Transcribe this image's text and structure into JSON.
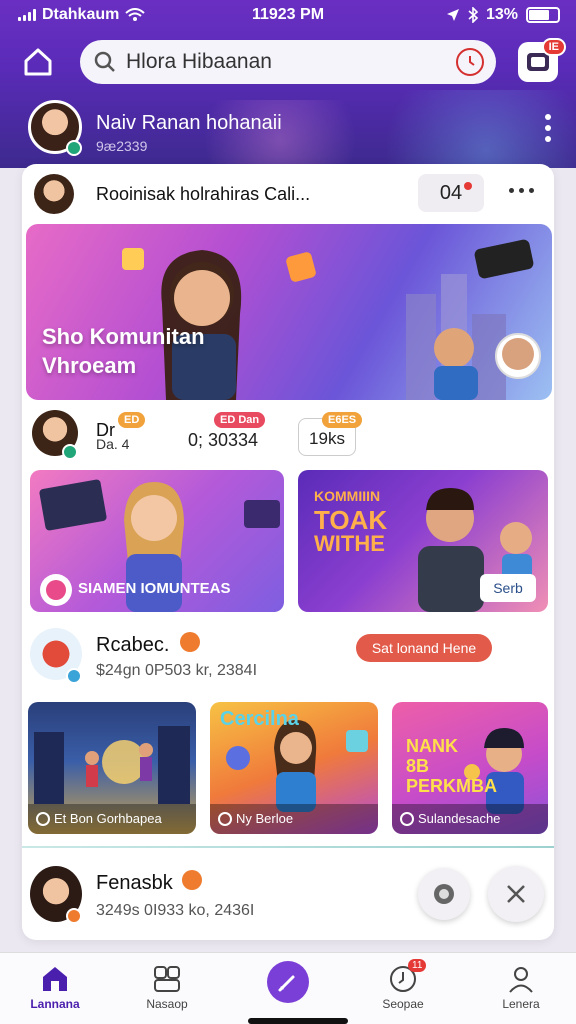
{
  "status_bar": {
    "carrier": "Dtahkaum",
    "time": "11923 PM",
    "battery": "13%"
  },
  "search": {
    "placeholder": "Hlora Hibaanan"
  },
  "header_badge": "IE",
  "profile": {
    "name": "Naiv Ranan hohanaii",
    "sub": "9æ2339"
  },
  "post": {
    "title": "Rooinisak holrahiras Cali...",
    "count": "04",
    "hero_text_1": "Sho Komunitan",
    "hero_text_2": "Vhroeam"
  },
  "meta": {
    "name": "Dr",
    "sub": "Da. 4",
    "pill1": "ED",
    "pill2": "ED Dan",
    "value": "0; 30334",
    "box_badge": "E6ES",
    "box_value": "19ks"
  },
  "tiles": {
    "left_label": "SIAMEN IOMUNTEAS",
    "right_title_1": "KOMMIIIN",
    "right_title_2": "TOAK",
    "right_title_3": "WITHE",
    "right_btn": "Serb"
  },
  "user1": {
    "name": "Rcabec.",
    "sub": "$24gn 0P503 kr, 2384I",
    "follow": "Sat lonand Hene"
  },
  "small_tiles": [
    {
      "title": "",
      "caption": "Et Bon Gorhbapea"
    },
    {
      "title": "Cercilna",
      "caption": "Ny Berloe"
    },
    {
      "title": "NANK 8B PERKMBA",
      "caption": "Sulandesache"
    }
  ],
  "user2": {
    "name": "Fenasbk",
    "sub": "3249s 0I933 ko, 2436I"
  },
  "tabs": [
    {
      "label": "Lannana",
      "active": true
    },
    {
      "label": "Nasaop"
    },
    {
      "label": ""
    },
    {
      "label": "Seopae",
      "badge": "11"
    },
    {
      "label": "Lenera"
    }
  ],
  "colors": {
    "brand": "#5a2bb8",
    "accent": "#7a3fd6",
    "alert": "#e53935"
  }
}
